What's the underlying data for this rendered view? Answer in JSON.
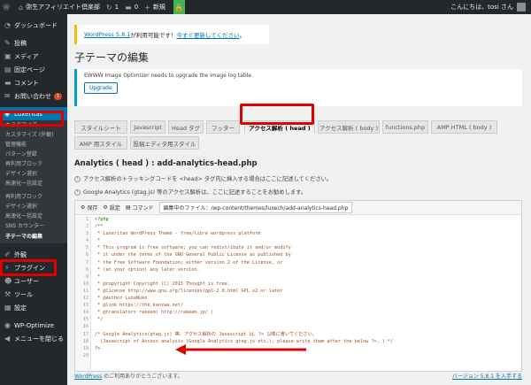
{
  "adminbar": {
    "site_name": "弥生アフィリエイト倶楽部",
    "updates_count": "1",
    "comments_count": "0",
    "new_label": "新規",
    "howdy": "こんにちは、tosi さん"
  },
  "sidebar": {
    "dashboard": "ダッシュボード",
    "posts": "投稿",
    "media": "メディア",
    "pages": "固定ページ",
    "comments": "コメント",
    "contact": "お問い合わせ",
    "contact_badge": "1",
    "luxeritas": "Luxeritas",
    "sub_items": [
      "カスタマイズ",
      "カスタマイズ (外観)",
      "管理機能",
      "パターン登録",
      "再利用ブロック",
      "デザイン選択",
      "高速化一括設定",
      "",
      "再利用ブロック",
      "デザイン選択",
      "高速化一括設定",
      "SNS カウンター",
      "子テーマの編集"
    ],
    "appearance": "外観",
    "plugins": "プラグイン",
    "users": "ユーザー",
    "tools": "ツール",
    "settings": "設定",
    "wp_optimize": "WP-Optimize",
    "collapse": "メニューを閉じる"
  },
  "notices": {
    "update_link1": "WordPress 5.8.1",
    "update_mid": " が利用可能です！",
    "update_link2": "今すぐ更新してください",
    "update_end": "。",
    "ewww_text": "EWWW Image Optimizer needs to upgrade the image log table.",
    "upgrade_button": "Upgrade"
  },
  "page_title": "子テーマの編集",
  "tabs": [
    "スタイルシート",
    "Javascript",
    "Head タグ",
    "フッター",
    "アクセス解析 ( head )",
    "アクセス解析 ( body )",
    "functions.php",
    "AMP HTML ( body )",
    "AMP 用スタイル",
    "投稿エディタ用スタイル"
  ],
  "section_title": "Analytics ( head ) : add-analytics-head.php",
  "info1": "アクセス解析のトラッキングコードを <head> タグ内に挿入する場合はここに記述してください。",
  "info2": "Google Analytics (gtag.js) 等のアクセス解析は、ここに記述することをお勧めします。",
  "editor": {
    "save": "保存",
    "settings": "設定",
    "command": "コマンド",
    "file_label": "編集中のファイル：/wp-content/themes/luxech/add-analytics-head.php",
    "lines": [
      "<?php",
      "/**",
      " * Luxeritas WordPress Theme - free/libre wordpress platform",
      " *",
      " * This program is free software; you can redistribute it and/or modify",
      " * it under the terms of the GNU General Public License as published by",
      " * the Free Software Foundation; either version 2 of the License, or",
      " * (at your option) any later version.",
      " *",
      " * @copyright Copyright (C) 2015 Thought is free.",
      " * @license http://www.gnu.org/licenses/gpl-2.0.html GPL v2 or later",
      " * @author LunaNuko",
      " * @link https://thk.kanzae.net/",
      " * @translators rakeem( http://rakeem.jp/ )",
      " */",
      "",
      "/* Google Analytics(gtag.js) 等、アクセス解析の Javascript は、?> 以降に書いてください。",
      "  (Javascript of Access analysis (Google Analytics gtag.js etc.), please write them after the below ?>. ) */",
      "?>",
      ""
    ]
  },
  "footer": {
    "left_link": "WordPress",
    "left_rest": " のご利用ありがとうございます。",
    "right_link": "バージョン 5.8.1 を入手する"
  },
  "colors": {
    "admin_dark": "#23282d",
    "active_blue": "#0073aa",
    "annotation_red": "#e00000",
    "update_yellow": "#ffb900"
  }
}
